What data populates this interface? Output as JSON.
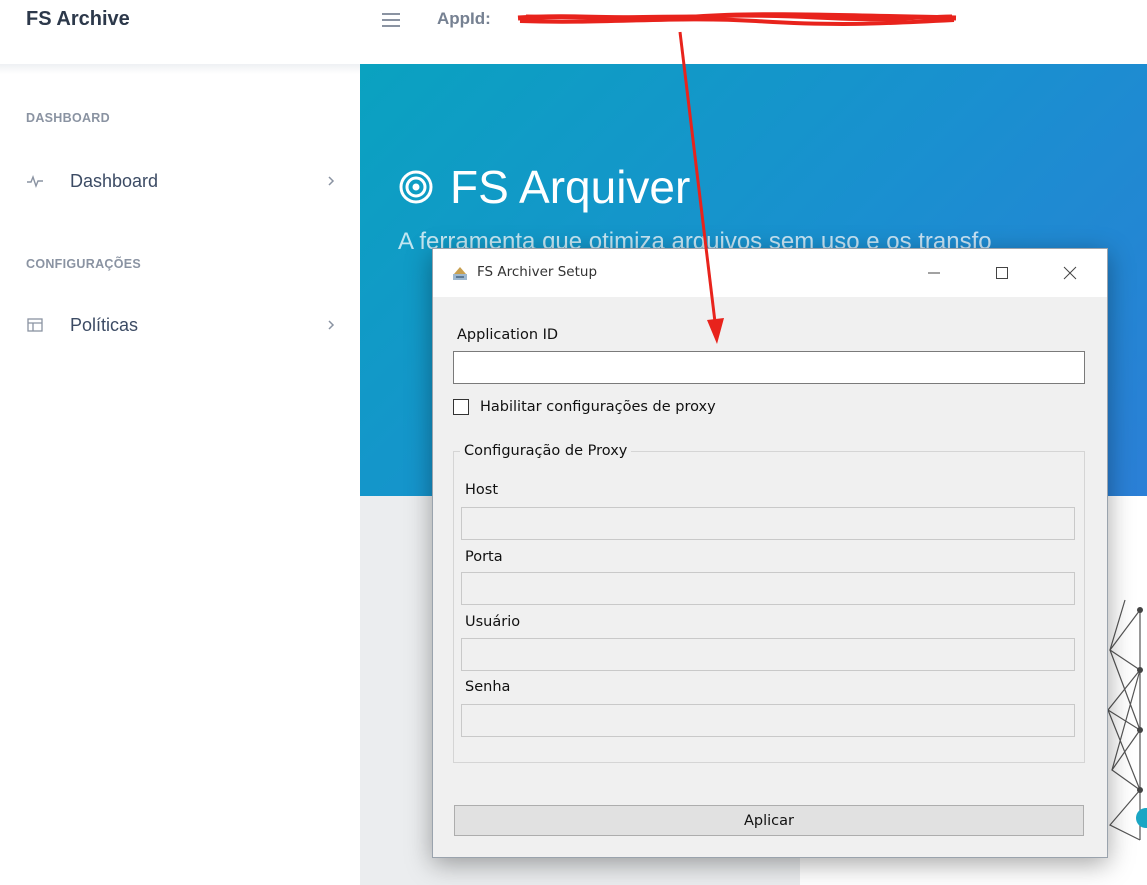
{
  "header": {
    "brand": "FS Archive",
    "appid_label": "AppId:",
    "menu_icon": "hamburger-icon"
  },
  "sidebar": {
    "sections": [
      {
        "title": "DASHBOARD",
        "items": [
          {
            "label": "Dashboard",
            "icon": "activity-icon"
          }
        ]
      },
      {
        "title": "CONFIGURAÇÕES",
        "items": [
          {
            "label": "Políticas",
            "icon": "layout-icon"
          }
        ]
      }
    ]
  },
  "hero": {
    "title": "FS Arquiver",
    "subtitle": "A ferramenta que otimiza arquivos sem uso e os transfo",
    "icon": "target-icon"
  },
  "dialog": {
    "title": "FS Archiver Setup",
    "app_id_label": "Application ID",
    "app_id_value": "",
    "proxy_checkbox_label": "Habilitar configurações de proxy",
    "proxy_checkbox_checked": false,
    "proxy_group_title": "Configuração de Proxy",
    "fields": [
      {
        "label": "Host",
        "value": ""
      },
      {
        "label": "Porta",
        "value": ""
      },
      {
        "label": "Usuário",
        "value": ""
      },
      {
        "label": "Senha",
        "value": ""
      }
    ],
    "apply_label": "Aplicar"
  },
  "colors": {
    "annotation_red": "#e8231c",
    "hero_start": "#0aa2c0",
    "hero_end": "#2b7fd6"
  }
}
